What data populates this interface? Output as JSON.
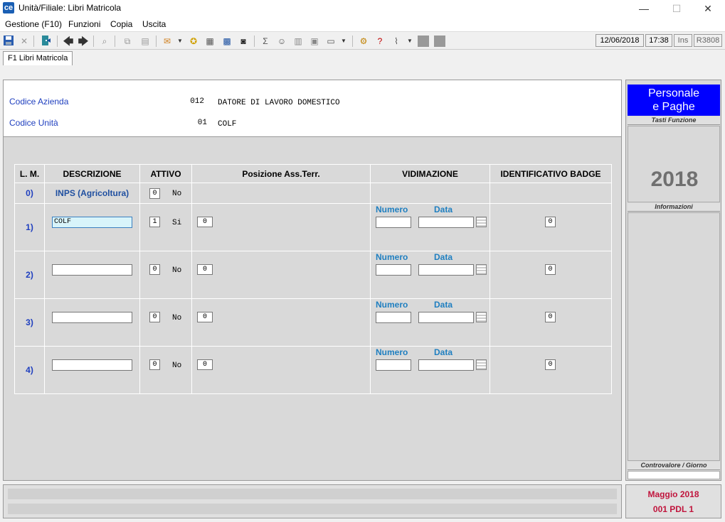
{
  "window": {
    "title": "Unità/Filiale: Libri Matricola",
    "app_icon": "ce",
    "minimize": "—",
    "maximize": "☐",
    "close": "✕"
  },
  "menu": [
    "Gestione (F10)",
    "Funzioni",
    "Copia",
    "Uscita"
  ],
  "status": {
    "date": "12/06/2018",
    "time": "17:38",
    "mode": "Ins",
    "code": "R3808"
  },
  "tab": "F1 Libri Matricola",
  "header": {
    "azienda_label": "Codice Azienda",
    "azienda_code": "012",
    "azienda_name": "DATORE DI LAVORO DOMESTICO",
    "unita_label": "Codice Unità",
    "unita_code": "01",
    "unita_name": "COLF"
  },
  "table": {
    "headers": [
      "L. M.",
      "DESCRIZIONE",
      "ATTIVO",
      "Posizione Ass.Terr.",
      "VIDIMAZIONE",
      "IDENTIFICATIVO BADGE"
    ],
    "vid_numero": "Numero",
    "vid_data": "Data",
    "row0": {
      "lm": "0)",
      "descrizione": "INPS (Agricoltura)",
      "attivo": "0",
      "attivo_text": "No"
    },
    "rows": [
      {
        "lm": "1)",
        "descrizione": "COLF",
        "attivo": "1",
        "attivo_text": "Si",
        "posizione": "0",
        "numero": "",
        "data": "",
        "badge": "0"
      },
      {
        "lm": "2)",
        "descrizione": "",
        "attivo": "0",
        "attivo_text": "No",
        "posizione": "0",
        "numero": "",
        "data": "",
        "badge": "0"
      },
      {
        "lm": "3)",
        "descrizione": "",
        "attivo": "0",
        "attivo_text": "No",
        "posizione": "0",
        "numero": "",
        "data": "",
        "badge": "0"
      },
      {
        "lm": "4)",
        "descrizione": "",
        "attivo": "0",
        "attivo_text": "No",
        "posizione": "0",
        "numero": "",
        "data": "",
        "badge": "0"
      }
    ]
  },
  "right_panel": {
    "brand_line1": "Personale",
    "brand_line2": "e Paghe",
    "tasti_funzione": "Tasti Funzione",
    "year": "2018",
    "informazioni": "Informazioni",
    "controvalore": "Controvalore / Giorno"
  },
  "footer": {
    "period": "Maggio   2018",
    "pdl": "001 PDL 1"
  },
  "colors": {
    "label_blue": "#1f3fbf",
    "brand_blue": "#0000ff",
    "footer_red": "#c0143c"
  }
}
